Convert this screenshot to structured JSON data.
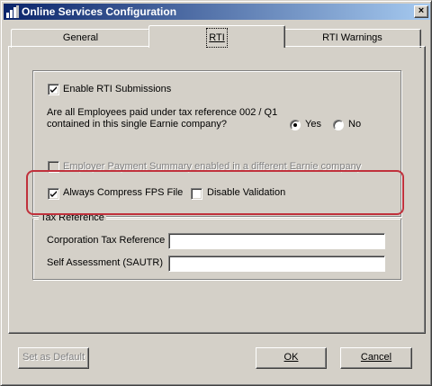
{
  "window": {
    "title": "Online Services Configuration",
    "close_glyph": "×"
  },
  "tabs": [
    {
      "label": "General",
      "active": false
    },
    {
      "label": "RTI",
      "active": true
    },
    {
      "label": "RTI Warnings",
      "active": false
    }
  ],
  "rti": {
    "enable_submissions": {
      "label": "Enable RTI Submissions",
      "checked": true
    },
    "question_line1": "Are all Employees paid under tax reference 002 / Q1",
    "question_line2": "contained in this single Earnie company?",
    "yes_label": "Yes",
    "no_label": "No",
    "selected_answer": "Yes",
    "eps_label": "Employer Payment Summary enabled in a different Earnie company",
    "always_compress": {
      "label": "Always Compress FPS File",
      "checked": true
    },
    "disable_validation": {
      "label": "Disable Validation",
      "checked": false
    }
  },
  "tax_reference": {
    "legend": "Tax Reference",
    "corporation_label": "Corporation Tax Reference",
    "corporation_value": "",
    "self_assessment_label": "Self Assessment (SAUTR)",
    "self_assessment_value": ""
  },
  "buttons": {
    "set_default": "Set as Default",
    "ok": "OK",
    "cancel": "Cancel"
  },
  "colors": {
    "titlebar_start": "#0a246a",
    "titlebar_end": "#a6caf0",
    "highlight": "#c0313c",
    "face": "#d4d0c8"
  }
}
